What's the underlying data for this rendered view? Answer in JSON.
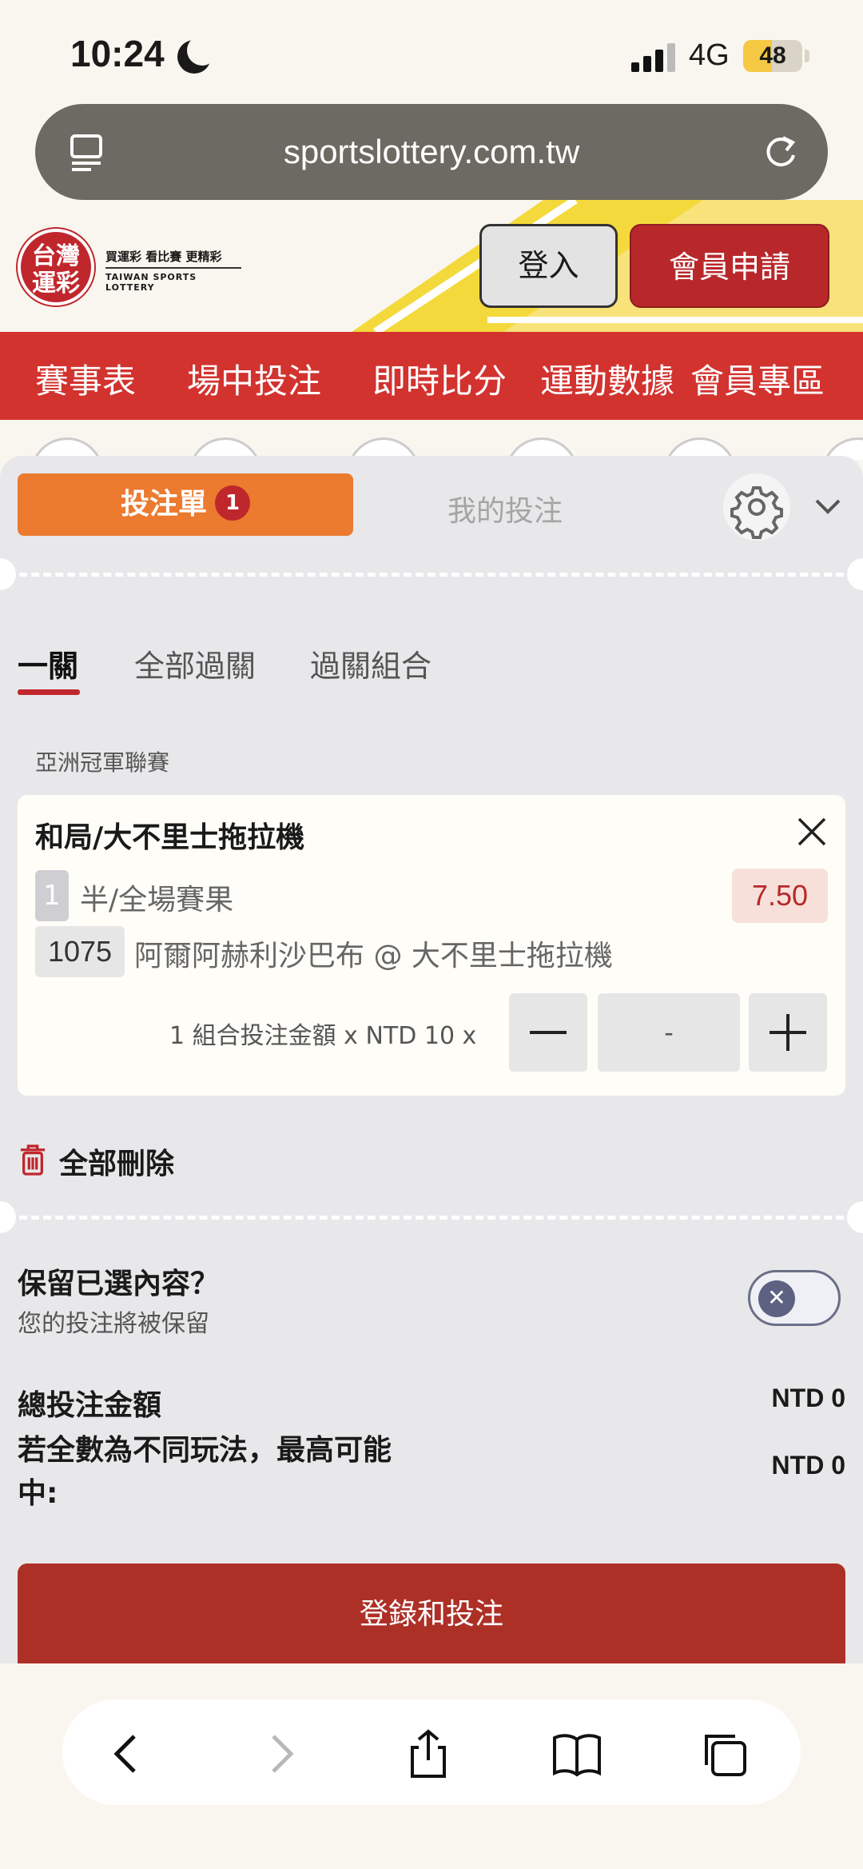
{
  "status": {
    "time": "10:24",
    "network": "4G",
    "battery": "48",
    "battery_level": 0.48
  },
  "browser": {
    "url": "sportslottery.com.tw"
  },
  "header": {
    "logo_title_line1": "台灣",
    "logo_title_line2": "運彩",
    "logo_slogan": "買運彩 看比賽 更精彩",
    "logo_english": "TAIWAN SPORTS LOTTERY",
    "login_label": "登入",
    "register_label": "會員申請"
  },
  "nav": {
    "items": [
      "賽事表",
      "場中投注",
      "即時比分",
      "運動數據",
      "會員專區"
    ]
  },
  "betslip": {
    "tab_active_label": "投注單",
    "tab_active_badge": "1",
    "tab_inactive_label": "我的投注",
    "sub_tabs": [
      "一關",
      "全部過關",
      "過關組合"
    ],
    "league": "亞洲冠軍聯賽",
    "selection": {
      "title": "和局/大不里士拖拉機",
      "market_number": "1",
      "market": "半/全場賽果",
      "odds": "7.50",
      "match_code": "1075",
      "teams": "阿爾阿赫利沙巴布 @ 大不里士拖拉機",
      "stake_label": "1 組合投注金額 x NTD 10 x",
      "stake_value": "-"
    },
    "delete_all_label": "全部刪除",
    "keep_title": "保留已選內容？",
    "keep_subtitle": "您的投注將被保留",
    "total_label": "總投注金額",
    "total_value": "NTD 0",
    "max_win_label_line1": "若全數為不同玩法，最高可能",
    "max_win_label_line2": "中:",
    "max_win_value": "NTD 0",
    "submit_label": "登錄和投注"
  }
}
